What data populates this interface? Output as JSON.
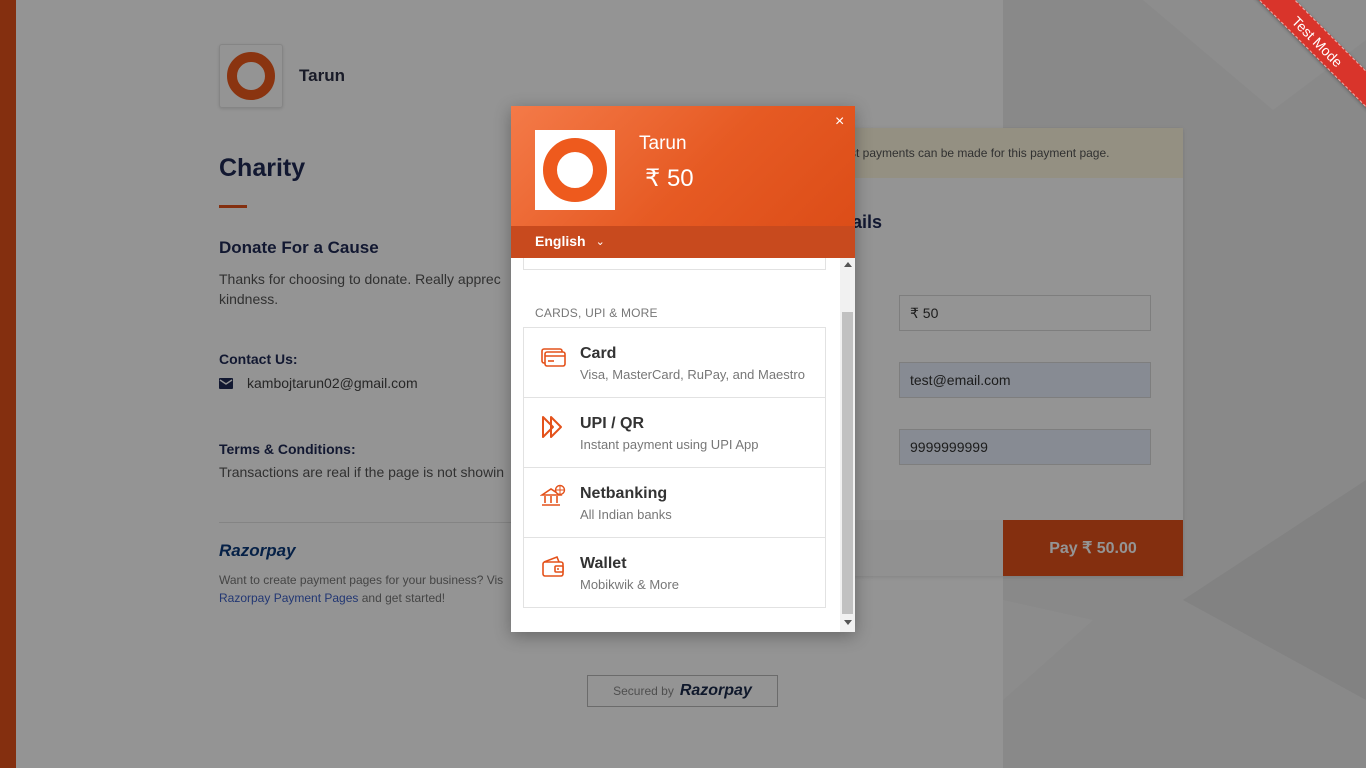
{
  "brand": {
    "name": "Tarun"
  },
  "page": {
    "title": "Charity",
    "cause_title": "Donate For a Cause",
    "cause_text_line1": "Thanks for choosing to donate. Really apprec",
    "cause_text_line2": "kindness.",
    "contact_heading": "Contact Us:",
    "contact_email": "kambojtarun02@gmail.com",
    "terms_heading": "Terms & Conditions:",
    "terms_text": "Transactions are real if the page is not showin",
    "razorpay_logo": "Razorpay",
    "footer_line1": "Want to create payment pages for your business? Vis",
    "footer_link": "Razorpay Payment Pages",
    "footer_line2_rest": " and get started!"
  },
  "right_card": {
    "test_notice": "st payments can be made for this payment page.",
    "details_title": "ails",
    "amount_value": "₹ 50",
    "email_value": "test@email.com",
    "phone_value": "9999999999",
    "pay_button": "Pay  ₹ 50.00"
  },
  "secured": {
    "prefix": "Secured by",
    "brand": "Razorpay"
  },
  "ribbon": {
    "label": "Test Mode"
  },
  "checkout": {
    "merchant_name": "Tarun",
    "amount": "₹ 50",
    "close_label": "×",
    "language": "English",
    "section_label": "CARDS, UPI & MORE",
    "methods": [
      {
        "title": "Card",
        "subtitle": "Visa, MasterCard, RuPay, and Maestro",
        "icon": "card-icon"
      },
      {
        "title": "UPI / QR",
        "subtitle": "Instant payment using UPI App",
        "icon": "upi-icon"
      },
      {
        "title": "Netbanking",
        "subtitle": "All Indian banks",
        "icon": "bank-icon"
      },
      {
        "title": "Wallet",
        "subtitle": "Mobikwik & More",
        "icon": "wallet-icon"
      }
    ]
  },
  "colors": {
    "accent": "#e4521b",
    "navy": "#1f2a55",
    "overlay": "rgba(0,0,0,0.42)"
  }
}
